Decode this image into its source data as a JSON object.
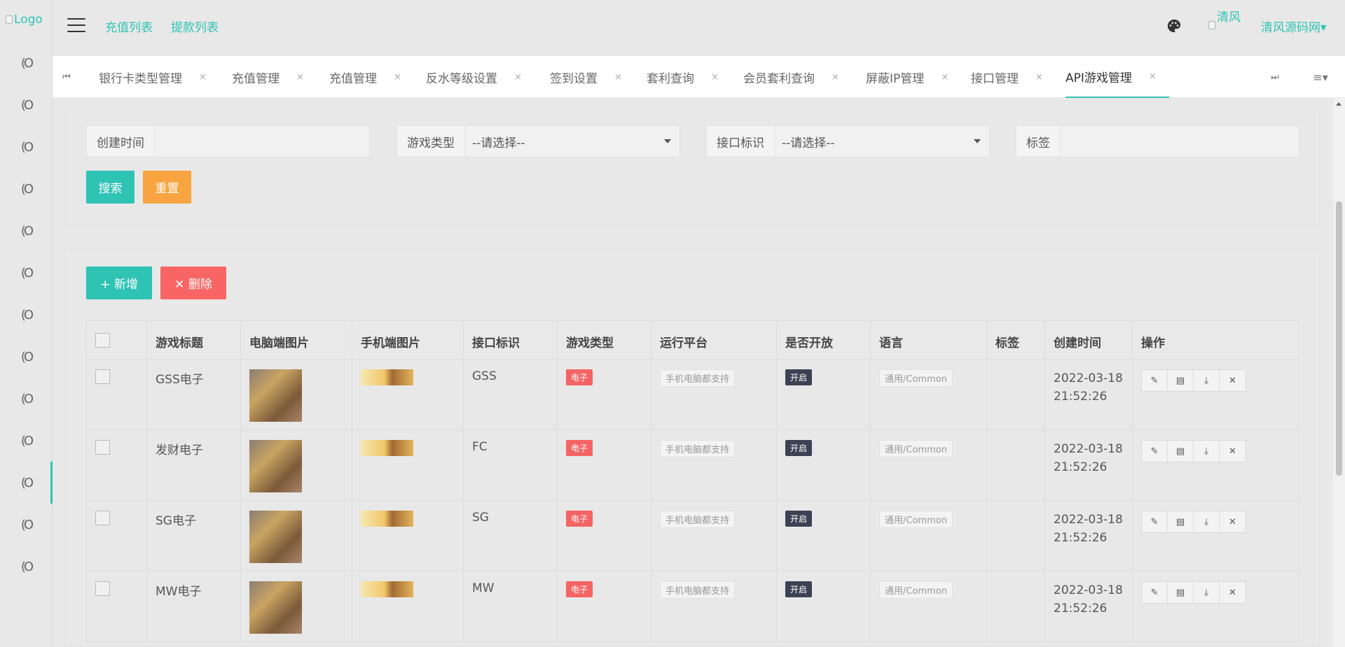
{
  "brand": {
    "logo_alt": "Logo",
    "accent": "#2fc3b4"
  },
  "header": {
    "links": [
      "充值列表",
      "提款列表"
    ],
    "avatar_alt": "清风",
    "user_name": "清风源码网"
  },
  "sidebar": {
    "item_count": 13,
    "active_index": 10
  },
  "tabs": [
    {
      "label": "银行卡类型管理"
    },
    {
      "label": "充值管理"
    },
    {
      "label": "充值管理"
    },
    {
      "label": "反水等级设置"
    },
    {
      "label": "签到设置"
    },
    {
      "label": "套利查询"
    },
    {
      "label": "会员套利查询"
    },
    {
      "label": "屏蔽IP管理"
    },
    {
      "label": "接口管理"
    },
    {
      "label": "API游戏管理"
    }
  ],
  "search": {
    "created_label": "创建时间",
    "created_value": "",
    "game_type_label": "游戏类型",
    "game_type_value": "--请选择--",
    "api_flag_label": "接口标识",
    "api_flag_value": "--请选择--",
    "tag_label": "标签",
    "tag_value": "",
    "search_btn": "搜索",
    "reset_btn": "重置"
  },
  "toolbar": {
    "add_btn": "+ 新增",
    "delete_btn": "✕ 删除"
  },
  "table": {
    "columns": [
      "游戏标题",
      "电脑端图片",
      "手机端图片",
      "接口标识",
      "游戏类型",
      "运行平台",
      "是否开放",
      "语言",
      "标签",
      "创建时间",
      "操作"
    ],
    "rows": [
      {
        "title": "GSS电子",
        "api": "GSS",
        "type": "电子",
        "platform": "手机电脑都支持",
        "open": "开启",
        "lang": "通用/Common",
        "tag": "",
        "date": "2022-03-18",
        "time": "21:52:26"
      },
      {
        "title": "发财电子",
        "api": "FC",
        "type": "电子",
        "platform": "手机电脑都支持",
        "open": "开启",
        "lang": "通用/Common",
        "tag": "",
        "date": "2022-03-18",
        "time": "21:52:26"
      },
      {
        "title": "SG电子",
        "api": "SG",
        "type": "电子",
        "platform": "手机电脑都支持",
        "open": "开启",
        "lang": "通用/Common",
        "tag": "",
        "date": "2022-03-18",
        "time": "21:52:26"
      },
      {
        "title": "MW电子",
        "api": "MW",
        "type": "电子",
        "platform": "手机电脑都支持",
        "open": "开启",
        "lang": "通用/Common",
        "tag": "",
        "date": "2022-03-18",
        "time": "21:52:26"
      }
    ]
  }
}
